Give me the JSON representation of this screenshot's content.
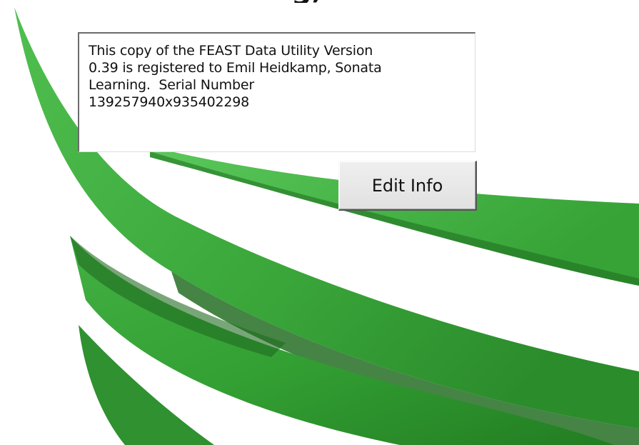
{
  "header": {
    "partial_title_glyph": "g,"
  },
  "registration": {
    "text": "This copy of the FEAST Data Utility Version\n0.39 is registered to Emil Heidkamp, Sonata\nLearning.  Serial Number\n139257940x935402298"
  },
  "buttons": {
    "edit_info_label": "Edit Info"
  },
  "colors": {
    "swoosh_light": "#5cc45a",
    "swoosh_mid": "#3aa33a",
    "swoosh_dark": "#1f6b1f",
    "background": "#ffffff"
  },
  "icons": {
    "background_graphic": "green-swoosh-logo"
  }
}
